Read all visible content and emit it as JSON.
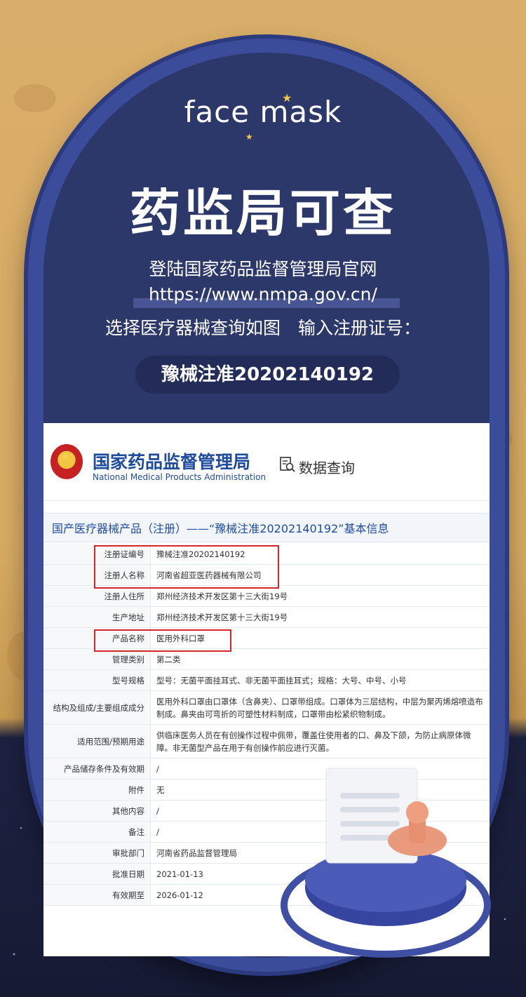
{
  "logo": "face mask",
  "headline": "药监局可查",
  "instructions": {
    "line1": "登陆国家药品监督管理局官网",
    "url": "https://www.nmpa.gov.cn/",
    "line3": "选择医疗器械查询如图　输入注册证号："
  },
  "registration_pill": "豫械注准20202140192",
  "site": {
    "org_cn": "国家药品监督管理局",
    "org_en": "National Medical Products Administration",
    "query_label": "数据查询",
    "subhead": "国产医疗器械产品（注册）——“豫械注准20202140192”基本信息"
  },
  "table": [
    {
      "k": "注册证编号",
      "v": "豫械注准20202140192"
    },
    {
      "k": "注册人名称",
      "v": "河南省超亚医药器械有限公司"
    },
    {
      "k": "注册人住所",
      "v": "郑州经济技术开发区第十三大街19号"
    },
    {
      "k": "生产地址",
      "v": "郑州经济技术开发区第十三大街19号"
    },
    {
      "k": "产品名称",
      "v": "医用外科口罩"
    },
    {
      "k": "管理类别",
      "v": "第二类"
    },
    {
      "k": "型号规格",
      "v": "型号：无菌平面挂耳式、非无菌平面挂耳式；规格：大号、中号、小号"
    },
    {
      "k": "结构及组成/主要组成成分",
      "v": "医用外科口罩由口罩体（含鼻夹）、口罩带组成。口罩体为三层结构，中层为聚丙烯熔喷造布制成。鼻夹由可弯折的可塑性材料制成，口罩带由松紧织物制成。"
    },
    {
      "k": "适用范围/预期用途",
      "v": "供临床医务人员在有创操作过程中佩带，覆盖住使用者的口、鼻及下颌，为防止病原体微障。非无菌型产品在用于有创操作前应进行灭菌。"
    },
    {
      "k": "产品储存条件及有效期",
      "v": "/"
    },
    {
      "k": "附件",
      "v": "无"
    },
    {
      "k": "其他内容",
      "v": "/"
    },
    {
      "k": "备注",
      "v": "/"
    },
    {
      "k": "审批部门",
      "v": "河南省药品监督管理局"
    },
    {
      "k": "批准日期",
      "v": "2021-01-13"
    },
    {
      "k": "有效期至",
      "v": "2026-01-12"
    }
  ]
}
